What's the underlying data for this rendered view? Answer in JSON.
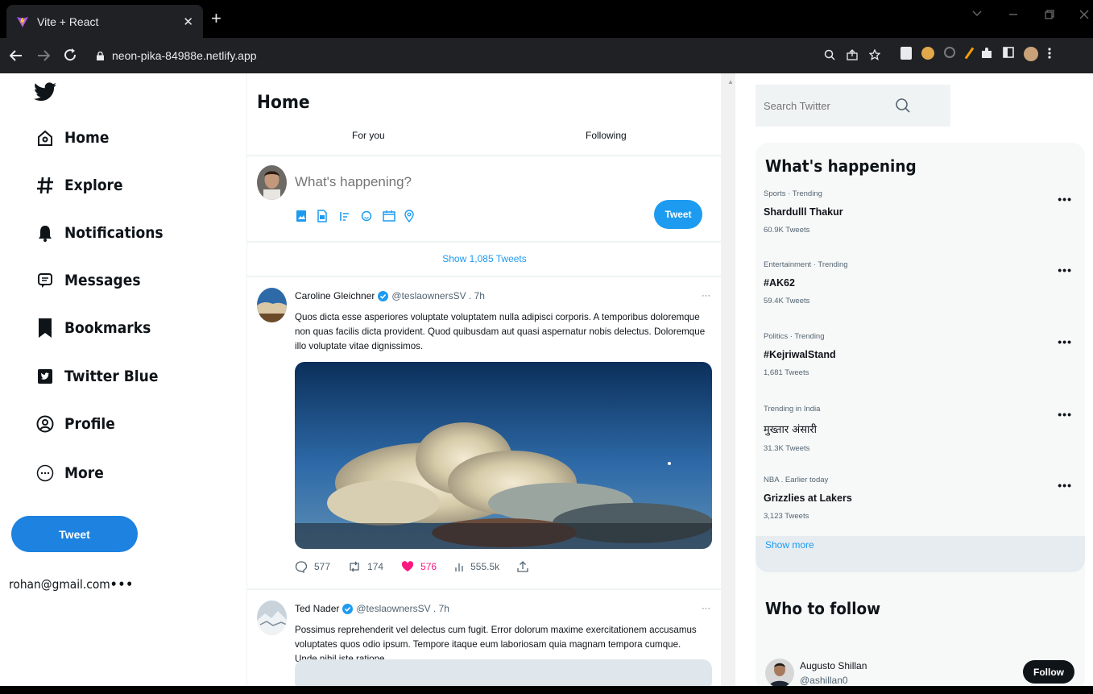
{
  "browser": {
    "tab_title": "Vite + React",
    "tab_close": "✕",
    "new_tab": "+",
    "url": "neon-pika-84988e.netlify.app"
  },
  "sidebar": {
    "items": [
      {
        "label": "Home",
        "icon": "home-icon"
      },
      {
        "label": "Explore",
        "icon": "hashtag-icon"
      },
      {
        "label": "Notifications",
        "icon": "bell-icon"
      },
      {
        "label": "Messages",
        "icon": "message-icon"
      },
      {
        "label": "Bookmarks",
        "icon": "bookmark-icon"
      },
      {
        "label": "Twitter Blue",
        "icon": "twitter-blue-icon"
      },
      {
        "label": "Profile",
        "icon": "profile-icon"
      },
      {
        "label": "More",
        "icon": "more-icon"
      }
    ],
    "tweet_button": "Tweet",
    "account": "rohan@gmail.com",
    "account_dots": "•••"
  },
  "feed": {
    "title": "Home",
    "tabs": [
      "For you",
      "Following"
    ],
    "compose_placeholder": "What's happening?",
    "compose_button": "Tweet",
    "show_tweets": "Show 1,085 Tweets",
    "posts": [
      {
        "name": "Caroline Gleichner",
        "handle": "@teslaownersSV . 7h",
        "more": "···",
        "body": "Quos dicta esse asperiores voluptate voluptatem nulla adipisci corporis. A temporibus doloremque non quas facilis dicta provident. Quod quibusdam aut quasi aspernatur nobis delectus. Doloremque illo voluptate vitae dignissimos.",
        "replies": "577",
        "retweets": "174",
        "likes": "576",
        "views": "555.5k"
      },
      {
        "name": "Ted Nader",
        "handle": "@teslaownersSV . 7h",
        "more": "···",
        "body": "Possimus reprehenderit vel delectus cum fugit. Error dolorum maxime exercitationem accusamus voluptates quos odio ipsum. Tempore itaque eum laboriosam quia magnam tempora cumque. Unde nihil iste ratione."
      }
    ]
  },
  "right": {
    "search_placeholder": "Search Twitter",
    "trends_title": "What's happening",
    "trends": [
      {
        "context": "Sports · Trending",
        "topic": "Shardulll Thakur",
        "count": "60.9K Tweets"
      },
      {
        "context": "Entertainment · Trending",
        "topic": "#AK62",
        "count": "59.4K Tweets"
      },
      {
        "context": "Politics · Trending",
        "topic": "#KejriwalStand",
        "count": "1,681 Tweets"
      },
      {
        "context": "Trending in India",
        "topic": "मुख्तार अंसारी",
        "count": "31.3K Tweets"
      },
      {
        "context": "NBA . Earlier today",
        "topic": "Grizzlies at Lakers",
        "count": "3,123 Tweets"
      }
    ],
    "trend_dots": "•••",
    "show_more": "Show more",
    "follow_title": "Who to follow",
    "follow": {
      "name": "Augusto Shillan",
      "handle": "@ashillan0",
      "button": "Follow"
    }
  },
  "colors": {
    "accent": "#1d9bf0",
    "like": "#f91880",
    "chrome_bg": "#202124"
  }
}
